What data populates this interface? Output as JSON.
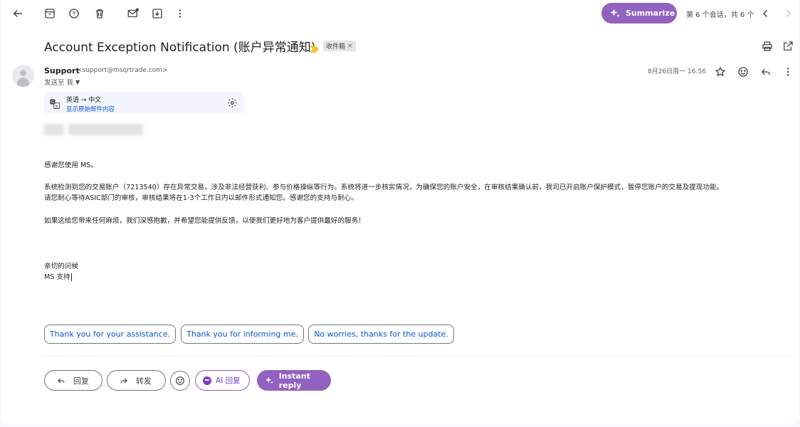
{
  "toolbar": {
    "back_icon": "arrow-left-icon",
    "archive_icon": "archive-icon",
    "report_icon": "report-spam-icon",
    "delete_icon": "trash-icon",
    "mark_unread_icon": "mark-unread-icon",
    "move_icon": "move-to-icon",
    "more_icon": "more-vert-icon",
    "summarize_label": "Summarize",
    "pager_text": "第 6 个会话，共 6 个",
    "prev_icon": "chevron-left-icon",
    "next_icon": "chevron-right-icon"
  },
  "email": {
    "subject": "Account Exception Notification (账户异常通知)",
    "label": "收件箱",
    "label_remove": "×",
    "sender_name": "Support",
    "sender_email": "<support@msqrtrade.com>",
    "recipient": "发送至 我",
    "date": "8月26日周一 16:56",
    "translation": {
      "languages": "英语 → 中文",
      "show_original": "显示原始邮件内容"
    },
    "body": {
      "greeting": "感谢您使用 MS。",
      "para1_line1": "系统检测到您的交易账户（7213540）存在异常交易，涉及非法经营获利、参与价格操纵等行为。系统将进一步核实情况，为确保您的账户安全，在审核结果确认前，我司已开启账户保护模式，暂停您账户的交易及提现功能。",
      "para1_line2": "请您耐心等待ASIC部门的审核，审核结果将在1-3个工作日内以邮件形式通知您。感谢您的支持与耐心。",
      "para2": "如果这给您带来任何麻烦，我们深感抱歉，并希望您能提供反馈，以便我们更好地为客户提供最好的服务！",
      "closing": "亲切的问候",
      "signature": "MS 支持"
    }
  },
  "smart_replies": [
    "Thank you for your assistance.",
    "Thank you for informing me.",
    "No worries, thanks for the update."
  ],
  "actions": {
    "reply_label": "回复",
    "forward_label": "转发",
    "ai_reply_label": "AI 回复",
    "instant_reply_label": "Instant reply"
  },
  "colors": {
    "accent_purple": "#9162bf",
    "link_blue": "#0b57d0",
    "importance_yellow": "#f2c231"
  }
}
